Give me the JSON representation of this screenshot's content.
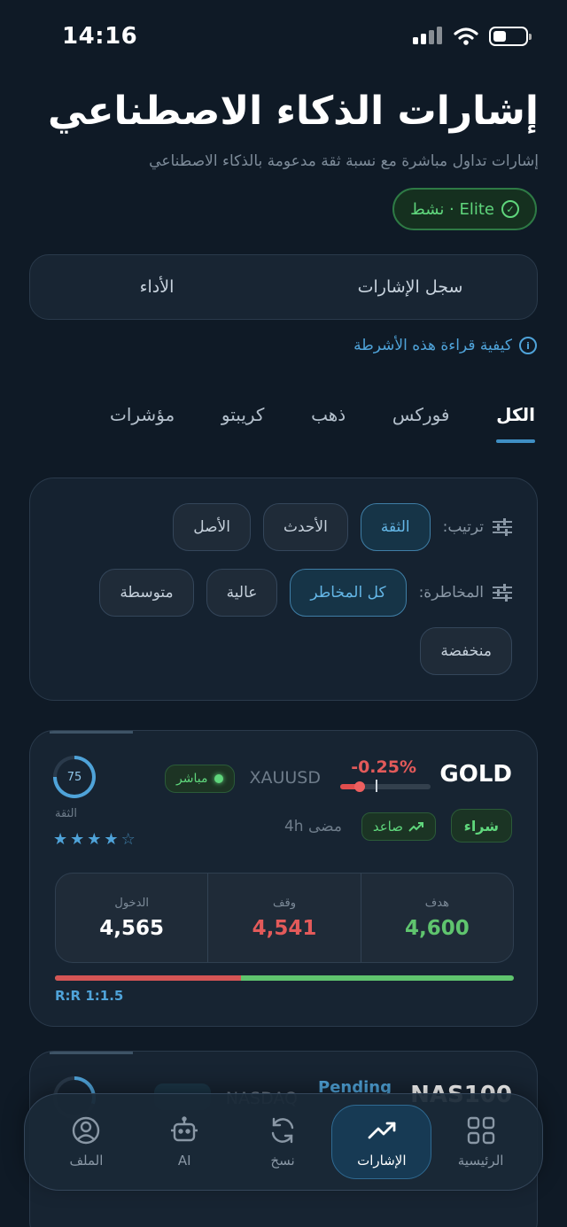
{
  "status": {
    "time": "14:16"
  },
  "header": {
    "title": "إشارات الذكاء الاصطناعي",
    "subtitle": "إشارات تداول مباشرة مع نسبة ثقة مدعومة بالذكاء الاصطناعي",
    "badge": "نشط · Elite"
  },
  "segment": {
    "history": "سجل الإشارات",
    "performance": "الأداء"
  },
  "howto": "كيفية قراءة هذه الأشرطة",
  "categories": [
    "الكل",
    "فوركس",
    "ذهب",
    "كريبتو",
    "مؤشرات"
  ],
  "filters": {
    "sort_label": "ترتيب:",
    "sort_options": [
      "الثقة",
      "الأحدث",
      "الأصل"
    ],
    "risk_label": "المخاطرة:",
    "risk_options": [
      "كل المخاطر",
      "عالية",
      "متوسطة",
      "منخفضة"
    ]
  },
  "signal": {
    "symbol": "GOLD",
    "change": "-0.25%",
    "pair": "XAUUSD",
    "live": "مباشر",
    "confidence": "75",
    "confidence_value": 0.75,
    "confidence_label": "الثقة",
    "stars": 4,
    "stars_max": 5,
    "action": "شراء",
    "trend": "صاعد",
    "ago": "مضى 4h",
    "target_label": "هدف",
    "target": "4,600",
    "stop_label": "وقف",
    "stop": "4,541",
    "entry_label": "الدخول",
    "entry": "4,565",
    "rr": "R:R 1:1.5"
  },
  "signal2": {
    "symbol": "NAS100",
    "status": "Pending",
    "pair": "NASDAQ"
  },
  "nav": [
    {
      "label": "الرئيسية",
      "icon": "grid-icon"
    },
    {
      "label": "الإشارات",
      "icon": "trending-up-icon"
    },
    {
      "label": "نسخ",
      "icon": "sync-icon"
    },
    {
      "label": "AI",
      "icon": "robot-icon"
    },
    {
      "label": "الملف",
      "icon": "user-icon"
    }
  ],
  "colors": {
    "accent": "#4fa3d9",
    "positive": "#5fd67c",
    "negative": "#e35a5a",
    "background": "#0f1a26"
  }
}
